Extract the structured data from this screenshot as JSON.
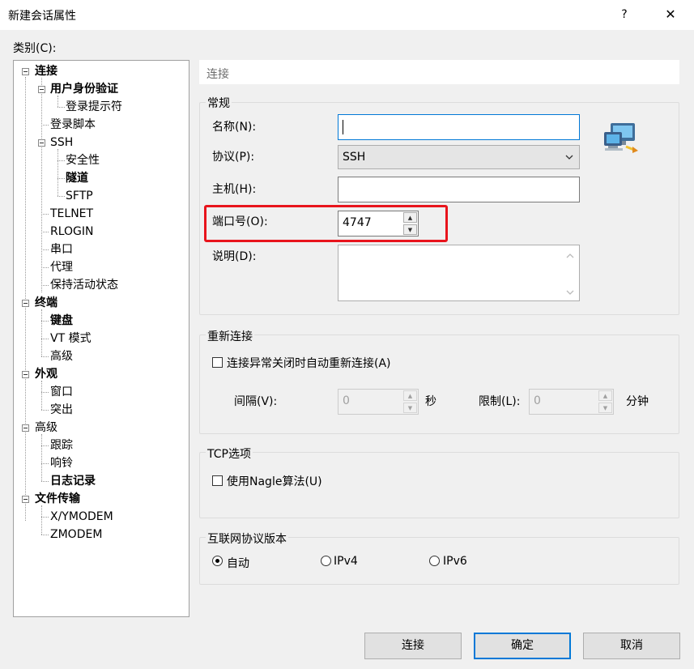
{
  "window": {
    "title": "新建会话属性",
    "help_glyph": "?",
    "close_glyph": "✕"
  },
  "category_label": "类别(C):",
  "tree": {
    "connection": "连接",
    "user_auth": "用户身份验证",
    "login_prompt": "登录提示符",
    "login_script": "登录脚本",
    "ssh": "SSH",
    "security": "安全性",
    "tunnel": "隧道",
    "sftp": "SFTP",
    "telnet": "TELNET",
    "rlogin": "RLOGIN",
    "serial": "串口",
    "proxy": "代理",
    "keepalive": "保持活动状态",
    "terminal": "终端",
    "keyboard": "键盘",
    "vt_mode": "VT 模式",
    "advanced_terminal": "高级",
    "appearance": "外观",
    "window": "窗口",
    "highlight": "突出",
    "advanced": "高级",
    "trace": "跟踪",
    "bell": "响铃",
    "logging": "日志记录",
    "file_transfer": "文件传输",
    "xymodem": "X/YMODEM",
    "zmodem": "ZMODEM"
  },
  "section_header": "连接",
  "general": {
    "title": "常规",
    "name_label": "名称(N):",
    "name_value": "",
    "protocol_label": "协议(P):",
    "protocol_value": "SSH",
    "host_label": "主机(H):",
    "host_value": "",
    "port_label": "端口号(O):",
    "port_value": "4747",
    "desc_label": "说明(D):",
    "desc_value": ""
  },
  "reconnect": {
    "title": "重新连接",
    "checkbox_label": "连接异常关闭时自动重新连接(A)",
    "interval_label": "间隔(V):",
    "interval_value": "0",
    "interval_unit": "秒",
    "limit_label": "限制(L):",
    "limit_value": "0",
    "limit_unit": "分钟"
  },
  "tcp": {
    "title": "TCP选项",
    "nagle_label": "使用Nagle算法(U)"
  },
  "ip_version": {
    "title": "互联网协议版本",
    "auto": "自动",
    "ipv4": "IPv4",
    "ipv6": "IPv6",
    "selected": "自动"
  },
  "buttons": {
    "connect": "连接",
    "ok": "确定",
    "cancel": "取消"
  },
  "colors": {
    "highlight_box": "#e8141c",
    "focus_blue": "#0078d7"
  }
}
